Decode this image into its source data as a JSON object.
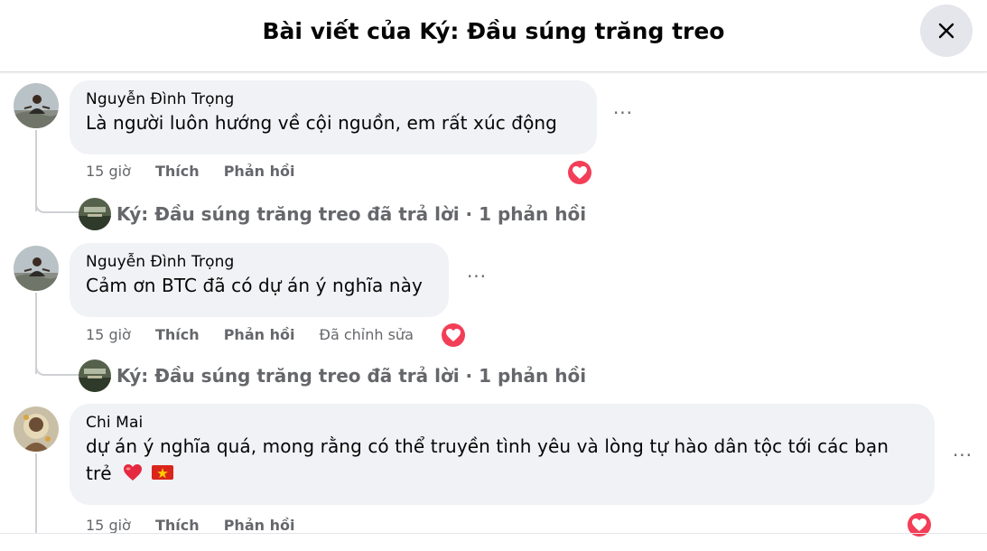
{
  "dialog": {
    "title": "Bài viết của Ký: Đầu súng trăng treo",
    "close_icon": "close-icon"
  },
  "comments": [
    {
      "author": "Nguyễn Đình Trọng",
      "text": "Là người luôn hướng về cội nguồn, em rất xúc động",
      "time": "15 giờ",
      "like_label": "Thích",
      "reply_label": "Phản hồi",
      "reaction": "heart-reaction-icon",
      "replies": "Ký: Đầu súng trăng treo đã trả lời · 1 phản hồi"
    },
    {
      "author": "Nguyễn Đình Trọng",
      "text": "Cảm ơn BTC đã có dự án ý nghĩa này",
      "time": "15 giờ",
      "like_label": "Thích",
      "reply_label": "Phản hồi",
      "edited_label": "Đã chỉnh sửa",
      "reaction": "heart-reaction-icon",
      "replies": "Ký: Đầu súng trăng treo đã trả lời · 1 phản hồi"
    },
    {
      "author": "Chi Mai",
      "text_line1": "dự án ý nghĩa quá, mong rằng có thể truyền tình yêu và lòng tự hào dân tộc tới các bạn",
      "text_line2": "trẻ",
      "emojis": [
        "red-heart-emoji",
        "vietnam-flag-emoji"
      ],
      "time": "15 giờ",
      "like_label": "Thích",
      "reply_label": "Phản hồi",
      "reaction": "heart-reaction-icon"
    }
  ],
  "more_label": "···",
  "colors": {
    "bubble": "#f0f2f5",
    "secondary_text": "#65676b",
    "heart": "#f33e58",
    "thread_line": "#ced0d4"
  }
}
